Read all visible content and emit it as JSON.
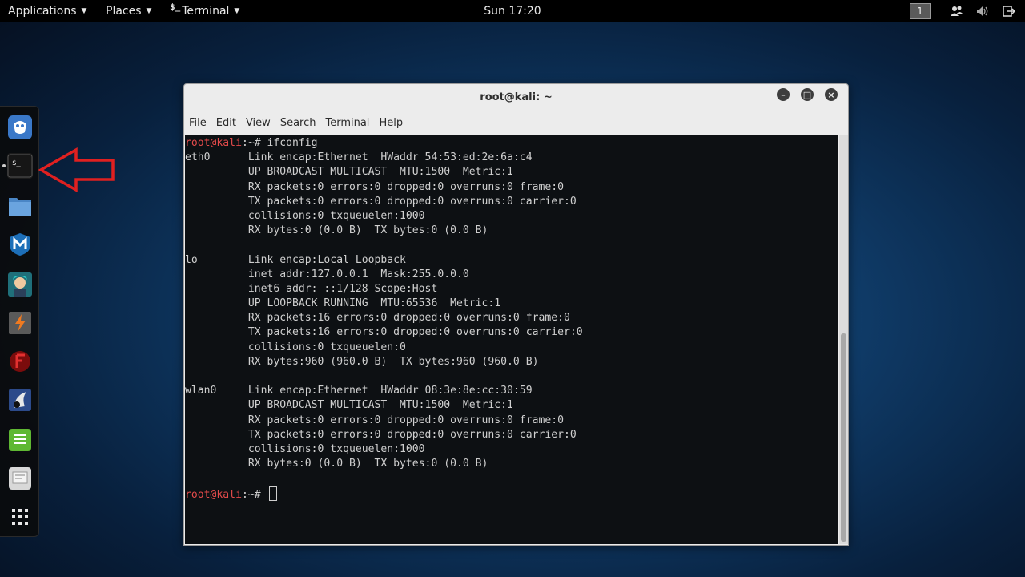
{
  "topbar": {
    "applications": "Applications",
    "places": "Places",
    "terminal_glyph": "$_",
    "terminal": "Terminal",
    "clock": "Sun 17:20",
    "workspace": "1"
  },
  "dock": {
    "items": [
      "kali-menu-icon",
      "terminal-icon",
      "files-icon",
      "metasploit-icon",
      "armitage-icon",
      "burpsuite-icon",
      "faraday-icon",
      "maltego-icon",
      "notes-icon",
      "app-icon",
      "show-apps-icon"
    ]
  },
  "window": {
    "title": "root@kali: ~",
    "menu": [
      "File",
      "Edit",
      "View",
      "Search",
      "Terminal",
      "Help"
    ]
  },
  "terminal": {
    "prompt_user": "root@kali",
    "prompt_suffix": ":~# ",
    "command": "ifconfig",
    "output": [
      "eth0      Link encap:Ethernet  HWaddr 54:53:ed:2e:6a:c4  ",
      "          UP BROADCAST MULTICAST  MTU:1500  Metric:1",
      "          RX packets:0 errors:0 dropped:0 overruns:0 frame:0",
      "          TX packets:0 errors:0 dropped:0 overruns:0 carrier:0",
      "          collisions:0 txqueuelen:1000 ",
      "          RX bytes:0 (0.0 B)  TX bytes:0 (0.0 B)",
      "",
      "lo        Link encap:Local Loopback  ",
      "          inet addr:127.0.0.1  Mask:255.0.0.0",
      "          inet6 addr: ::1/128 Scope:Host",
      "          UP LOOPBACK RUNNING  MTU:65536  Metric:1",
      "          RX packets:16 errors:0 dropped:0 overruns:0 frame:0",
      "          TX packets:16 errors:0 dropped:0 overruns:0 carrier:0",
      "          collisions:0 txqueuelen:0 ",
      "          RX bytes:960 (960.0 B)  TX bytes:960 (960.0 B)",
      "",
      "wlan0     Link encap:Ethernet  HWaddr 08:3e:8e:cc:30:59  ",
      "          UP BROADCAST MULTICAST  MTU:1500  Metric:1",
      "          RX packets:0 errors:0 dropped:0 overruns:0 frame:0",
      "          TX packets:0 errors:0 dropped:0 overruns:0 carrier:0",
      "          collisions:0 txqueuelen:1000 ",
      "          RX bytes:0 (0.0 B)  TX bytes:0 (0.0 B)",
      ""
    ]
  },
  "colors": {
    "prompt_user": "#e24a4a",
    "terminal_bg": "#0d1013",
    "annotation_arrow": "#e02020"
  }
}
